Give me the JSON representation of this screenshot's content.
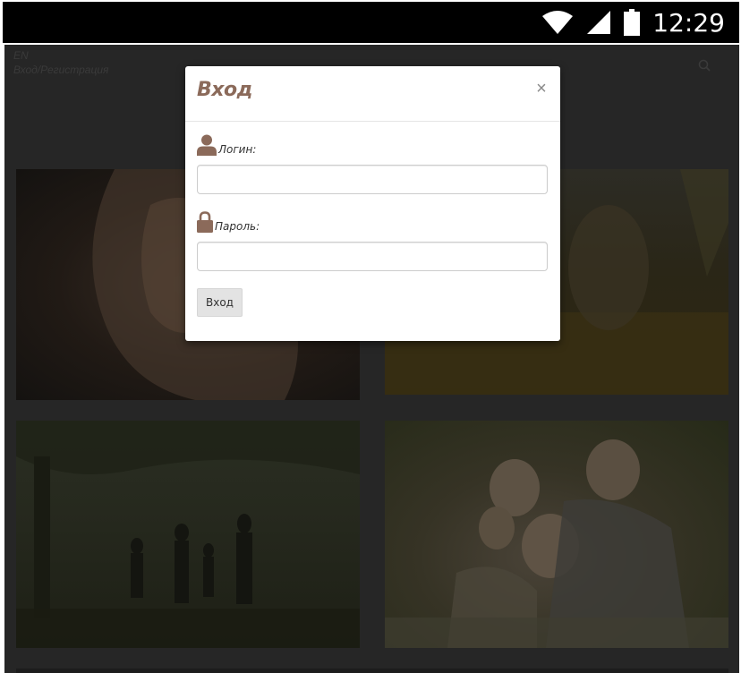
{
  "status_bar": {
    "time": "12:29",
    "icons": [
      "wifi-icon",
      "cell-signal-icon",
      "battery-icon"
    ]
  },
  "page": {
    "lang": "EN",
    "auth_link": "Вход/Регистрация",
    "search_icon": "search-icon"
  },
  "modal": {
    "title": "Вход",
    "close": "×",
    "login_label": "Логин:",
    "login_value": "",
    "password_label": "Пароль:",
    "password_value": "",
    "submit_label": "Вход",
    "accent_color": "#8b6a5a",
    "icons": [
      "user-icon",
      "lock-icon"
    ]
  }
}
